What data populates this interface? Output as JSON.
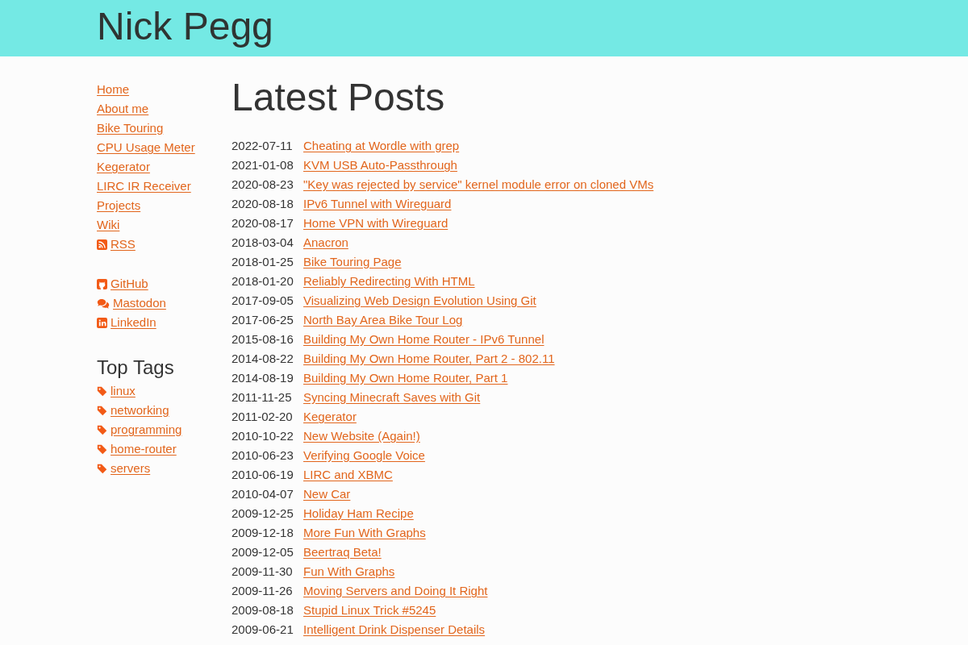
{
  "header": {
    "title": "Nick Pegg"
  },
  "sidebar": {
    "nav_links": [
      {
        "label": "Home",
        "kind": "text"
      },
      {
        "label": "About me",
        "kind": "text"
      },
      {
        "label": "Bike Touring",
        "kind": "text"
      },
      {
        "label": "CPU Usage Meter",
        "kind": "text"
      },
      {
        "label": "Kegerator",
        "kind": "text"
      },
      {
        "label": "LIRC IR Receiver",
        "kind": "text"
      },
      {
        "label": "Projects",
        "kind": "text"
      },
      {
        "label": "Wiki",
        "kind": "text"
      },
      {
        "label": "RSS",
        "kind": "rss"
      }
    ],
    "social_links": [
      {
        "label": "GitHub",
        "kind": "cat"
      },
      {
        "label": "Mastodon",
        "kind": "chat"
      },
      {
        "label": "LinkedIn",
        "kind": "in"
      }
    ],
    "tags_heading": "Top Tags",
    "tags": [
      "linux",
      "networking",
      "programming",
      "home-router",
      "servers"
    ]
  },
  "main": {
    "heading": "Latest Posts",
    "posts": [
      {
        "date": "2022-07-11",
        "title": "Cheating at Wordle with grep"
      },
      {
        "date": "2021-01-08",
        "title": "KVM USB Auto-Passthrough"
      },
      {
        "date": "2020-08-23",
        "title": "\"Key was rejected by service\" kernel module error on cloned VMs"
      },
      {
        "date": "2020-08-18",
        "title": "IPv6 Tunnel with Wireguard"
      },
      {
        "date": "2020-08-17",
        "title": "Home VPN with Wireguard"
      },
      {
        "date": "2018-03-04",
        "title": "Anacron"
      },
      {
        "date": "2018-01-25",
        "title": "Bike Touring Page"
      },
      {
        "date": "2018-01-20",
        "title": "Reliably Redirecting With HTML"
      },
      {
        "date": "2017-09-05",
        "title": "Visualizing Web Design Evolution Using Git"
      },
      {
        "date": "2017-06-25",
        "title": "North Bay Area Bike Tour Log"
      },
      {
        "date": "2015-08-16",
        "title": "Building My Own Home Router - IPv6 Tunnel"
      },
      {
        "date": "2014-08-22",
        "title": "Building My Own Home Router, Part 2 - 802.11"
      },
      {
        "date": "2014-08-19",
        "title": "Building My Own Home Router, Part 1"
      },
      {
        "date": "2011-11-25",
        "title": "Syncing Minecraft Saves with Git"
      },
      {
        "date": "2011-02-20",
        "title": "Kegerator"
      },
      {
        "date": "2010-10-22",
        "title": "New Website (Again!)"
      },
      {
        "date": "2010-06-23",
        "title": "Verifying Google Voice"
      },
      {
        "date": "2010-06-19",
        "title": "LIRC and XBMC"
      },
      {
        "date": "2010-04-07",
        "title": "New Car"
      },
      {
        "date": "2009-12-25",
        "title": "Holiday Ham Recipe"
      },
      {
        "date": "2009-12-18",
        "title": "More Fun With Graphs"
      },
      {
        "date": "2009-12-05",
        "title": "Beertraq Beta!"
      },
      {
        "date": "2009-11-30",
        "title": "Fun With Graphs"
      },
      {
        "date": "2009-11-26",
        "title": "Moving Servers and Doing It Right"
      },
      {
        "date": "2009-08-18",
        "title": "Stupid Linux Trick #5245"
      },
      {
        "date": "2009-06-21",
        "title": "Intelligent Drink Dispenser Details"
      }
    ]
  }
}
